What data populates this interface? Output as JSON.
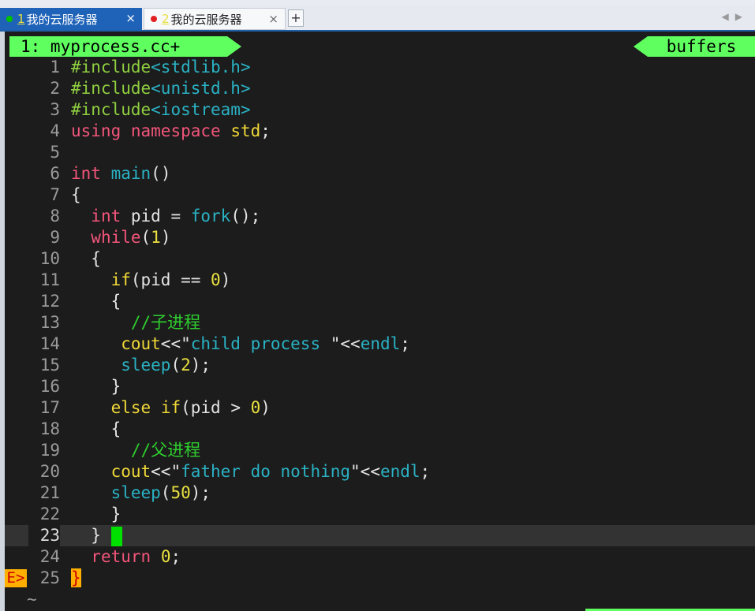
{
  "tabs": [
    {
      "num": "1",
      "label": "我的云服务器",
      "dot_color": "#00c000",
      "active": true
    },
    {
      "num": "2",
      "label": "我的云服务器",
      "dot_color": "#e02020",
      "active": false
    }
  ],
  "tab_close": "×",
  "new_tab": "+",
  "status": {
    "left": "1: myprocess.cc+",
    "right": "buffers"
  },
  "sign": "E>",
  "tilde": "~",
  "lines": [
    {
      "n": "1",
      "tokens": [
        [
          "pp",
          "#include"
        ],
        [
          "inc",
          "<stdlib.h>"
        ]
      ]
    },
    {
      "n": "2",
      "tokens": [
        [
          "pp",
          "#include"
        ],
        [
          "inc",
          "<unistd.h>"
        ]
      ]
    },
    {
      "n": "3",
      "tokens": [
        [
          "pp",
          "#include"
        ],
        [
          "inc",
          "<iostream>"
        ]
      ]
    },
    {
      "n": "4",
      "tokens": [
        [
          "k",
          "using"
        ],
        [
          "",
          " "
        ],
        [
          "k",
          "namespace"
        ],
        [
          "",
          " "
        ],
        [
          "obj",
          "std"
        ],
        [
          "",
          ";"
        ]
      ]
    },
    {
      "n": "5",
      "tokens": []
    },
    {
      "n": "6",
      "tokens": [
        [
          "ty",
          "int"
        ],
        [
          "",
          " "
        ],
        [
          "fn",
          "main"
        ],
        [
          "",
          "()"
        ]
      ]
    },
    {
      "n": "7",
      "tokens": [
        [
          "",
          "{"
        ]
      ]
    },
    {
      "n": "8",
      "tokens": [
        [
          "",
          "  "
        ],
        [
          "ty",
          "int"
        ],
        [
          "",
          " pid = "
        ],
        [
          "fn",
          "fork"
        ],
        [
          "",
          "();"
        ]
      ]
    },
    {
      "n": "9",
      "tokens": [
        [
          "",
          "  "
        ],
        [
          "k",
          "while"
        ],
        [
          "",
          "("
        ],
        [
          "num",
          "1"
        ],
        [
          "",
          ")"
        ]
      ]
    },
    {
      "n": "10",
      "tokens": [
        [
          "",
          "  {"
        ]
      ]
    },
    {
      "n": "11",
      "tokens": [
        [
          "",
          "    "
        ],
        [
          "obj",
          "if"
        ],
        [
          "",
          "(pid == "
        ],
        [
          "num",
          "0"
        ],
        [
          "",
          ")"
        ]
      ]
    },
    {
      "n": "12",
      "tokens": [
        [
          "",
          "    {"
        ]
      ]
    },
    {
      "n": "13",
      "tokens": [
        [
          "",
          "      "
        ],
        [
          "cm",
          "//子进程"
        ]
      ]
    },
    {
      "n": "14",
      "tokens": [
        [
          "",
          "     "
        ],
        [
          "obj",
          "cout"
        ],
        [
          "",
          "<<\""
        ],
        [
          "str",
          "child process "
        ],
        [
          "",
          "\"<<"
        ],
        [
          "fn",
          "endl"
        ],
        [
          "",
          ";"
        ]
      ]
    },
    {
      "n": "15",
      "tokens": [
        [
          "",
          "     "
        ],
        [
          "fn",
          "sleep"
        ],
        [
          "",
          "("
        ],
        [
          "num",
          "2"
        ],
        [
          "",
          ");"
        ]
      ]
    },
    {
      "n": "16",
      "tokens": [
        [
          "",
          "    }"
        ]
      ]
    },
    {
      "n": "17",
      "tokens": [
        [
          "",
          "    "
        ],
        [
          "obj",
          "else"
        ],
        [
          "",
          " "
        ],
        [
          "obj",
          "if"
        ],
        [
          "",
          "(pid > "
        ],
        [
          "num",
          "0"
        ],
        [
          "",
          ")"
        ]
      ]
    },
    {
      "n": "18",
      "tokens": [
        [
          "",
          "    {"
        ]
      ]
    },
    {
      "n": "19",
      "tokens": [
        [
          "",
          "      "
        ],
        [
          "cm",
          "//父进程"
        ]
      ]
    },
    {
      "n": "20",
      "tokens": [
        [
          "",
          "    "
        ],
        [
          "obj",
          "cout"
        ],
        [
          "",
          "<<\""
        ],
        [
          "str",
          "father do nothing"
        ],
        [
          "",
          "\"<<"
        ],
        [
          "fn",
          "endl"
        ],
        [
          "",
          ";"
        ]
      ]
    },
    {
      "n": "21",
      "tokens": [
        [
          "",
          "    "
        ],
        [
          "fn",
          "sleep"
        ],
        [
          "",
          "("
        ],
        [
          "num",
          "50"
        ],
        [
          "",
          ");"
        ]
      ]
    },
    {
      "n": "22",
      "tokens": [
        [
          "",
          "    }"
        ]
      ]
    },
    {
      "n": "23",
      "current": true,
      "tokens": [
        [
          "",
          "  } "
        ],
        [
          "cursor",
          ""
        ]
      ]
    },
    {
      "n": "24",
      "tokens": [
        [
          "",
          "  "
        ],
        [
          "k",
          "return"
        ],
        [
          "",
          " "
        ],
        [
          "num",
          "0"
        ],
        [
          "",
          ";"
        ]
      ]
    },
    {
      "n": "25",
      "sign": true,
      "tokens": [
        [
          "brace-hl",
          "}"
        ]
      ]
    }
  ]
}
